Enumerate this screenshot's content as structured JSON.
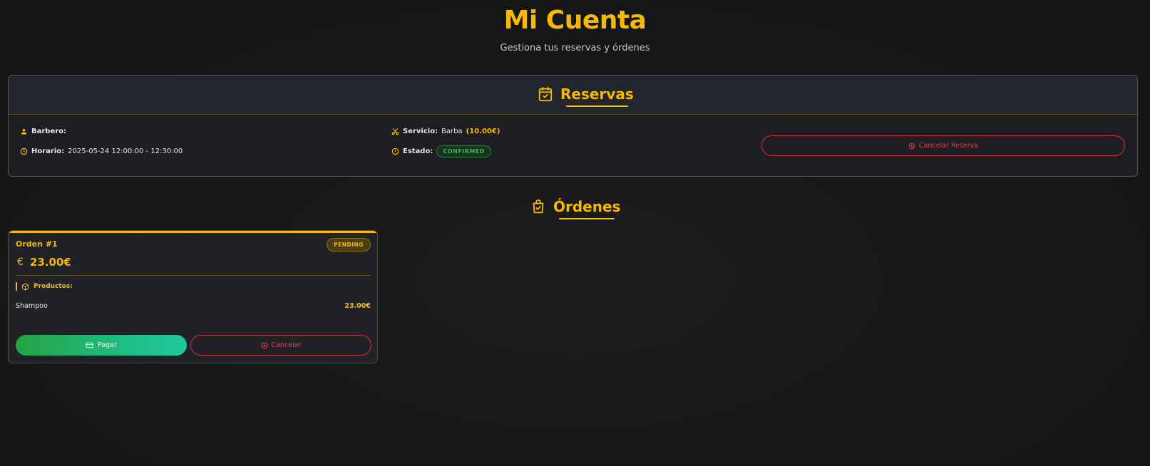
{
  "header": {
    "title": "Mi Cuenta",
    "subtitle": "Gestiona tus reservas y órdenes"
  },
  "reservations": {
    "heading": "Reservas",
    "heading_icon": "calendar-check-icon",
    "items": [
      {
        "barber_label": "Barbero:",
        "barber_value": "",
        "schedule_label": "Horario:",
        "schedule_value": "2025-05-24 12:00:00 - 12:30:00",
        "service_label": "Servicio:",
        "service_value": "Barba",
        "service_price": "(10.00€)",
        "status_label": "Estado:",
        "status_value": "CONFIRMED",
        "cancel_label": "Cancelar Reserva"
      }
    ]
  },
  "orders": {
    "heading": "Órdenes",
    "heading_icon": "shopping-bag-check-icon",
    "items": [
      {
        "title": "Orden #1",
        "status": "PENDING",
        "currency_symbol": "€",
        "total": "23.00€",
        "products_label": "Productos:",
        "products": [
          {
            "name": "Shampoo",
            "price": "23.00€"
          }
        ],
        "pay_label": "Pagar",
        "cancel_label": "Cancelar"
      }
    ]
  },
  "colors": {
    "accent": "#f5b90b",
    "danger": "#e2404d",
    "success": "#26a244",
    "background": "#161616"
  }
}
